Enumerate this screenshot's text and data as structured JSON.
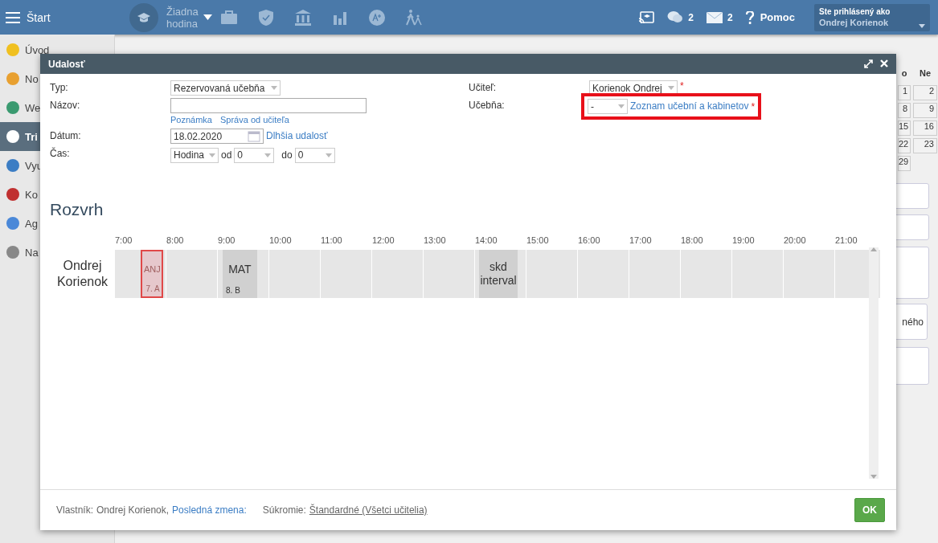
{
  "topbar": {
    "menu_label": "Štart",
    "lesson": "Žiadna hodina",
    "comments_count": "2",
    "messages_count": "2",
    "help": "Pomoc",
    "user": {
      "caption": "Ste prihlásený ako",
      "name": "Ondrej Korienok"
    }
  },
  "sidebar": {
    "items": [
      {
        "label": "Úvod",
        "selected": false
      },
      {
        "label": "No",
        "selected": false
      },
      {
        "label": "We",
        "selected": false
      },
      {
        "label": "Tri",
        "selected": true
      },
      {
        "label": "Vyu",
        "selected": false
      },
      {
        "label": "Ko",
        "selected": false
      },
      {
        "label": "Ag",
        "selected": false
      },
      {
        "label": "Na",
        "selected": false
      }
    ]
  },
  "calendar": {
    "headers": [
      "o",
      "Ne"
    ],
    "weeks": [
      [
        "1",
        "2"
      ],
      [
        "8",
        "9"
      ],
      [
        "15",
        "16"
      ],
      [
        "22",
        "23"
      ],
      [
        "29"
      ]
    ]
  },
  "side_card": "ného",
  "dialog": {
    "title": "Udalosť",
    "type": {
      "label": "Typ:",
      "value": "Rezervovaná učebňa"
    },
    "name": {
      "label": "Názov:",
      "links": [
        "Poznámka",
        "Správa od učiteľa"
      ]
    },
    "date": {
      "label": "Dátum:",
      "value": "18.02.2020",
      "link": "Dlhšia udalosť"
    },
    "time": {
      "label": "Čas:",
      "unit": "Hodina",
      "from_label": "od",
      "from": "0",
      "to_label": "do",
      "to": "0"
    },
    "teacher": {
      "label": "Učiteľ:",
      "value": "Korienok Ondrej",
      "required_mark": "*"
    },
    "room": {
      "label": "Učebňa:",
      "value": "-",
      "link": "Zoznam učební a kabinetov",
      "required_mark": "*",
      "highlighted": true
    },
    "schedule": {
      "title": "Rozvrh",
      "hours": [
        "7:00",
        "8:00",
        "9:00",
        "10:00",
        "11:00",
        "12:00",
        "13:00",
        "14:00",
        "15:00",
        "16:00",
        "17:00",
        "18:00",
        "19:00",
        "20:00",
        "21:00"
      ],
      "rows": [
        {
          "teacher": "Ondrej Korienok",
          "events": [
            {
              "label": "ANJ",
              "class_name": "7. A",
              "highlighted": true
            },
            {
              "label": "MAT",
              "class_name": "8. B",
              "highlighted": false
            },
            {
              "label": "skd interval",
              "highlighted": false
            }
          ]
        }
      ]
    },
    "footer": {
      "owner_label": "Vlastník:",
      "owner": "Ondrej Korienok,",
      "last_change": "Posledná zmena:",
      "privacy_label": "Súkromie:",
      "privacy": "Štandardné (Všetci učitelia)",
      "ok": "OK"
    }
  }
}
